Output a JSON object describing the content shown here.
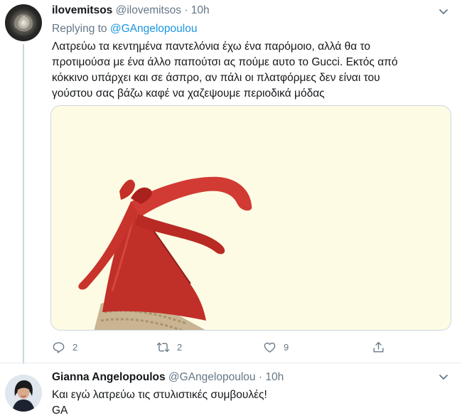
{
  "tweet1": {
    "name": "ilovemitsos",
    "handle": "@ilovemitsos",
    "separator": "·",
    "time": "10h",
    "replying_prefix": "Replying to",
    "replying_to": "@GAngelopoulou",
    "text_lines": [
      "Λατρεύω τα κεντημένα παντελόνια  έχω ένα παρόμοιο, αλλά θα το",
      "προτιμούσα με ένα άλλο παπούτσι ας πούμε αυτο το Gucci. Εκτός από",
      "κόκκινο υπάρχει και σε άσπρο, αν πάλι οι πλατφόρμες δεν είναι του",
      "γούστου σας βάζω καφέ να χαζεψουμε περιοδικά μόδας"
    ],
    "actions": {
      "reply_count": "2",
      "retweet_count": "2",
      "like_count": "9"
    },
    "icons": {
      "caret": "chevron-down-icon",
      "reply": "reply-icon",
      "retweet": "retweet-icon",
      "like": "heart-icon",
      "share": "share-icon"
    }
  },
  "tweet2": {
    "name": "Gianna Angelopoulos",
    "handle": "@GAngelopoulou",
    "separator": "·",
    "time": "10h",
    "text_lines": [
      "Και εγώ λατρεύω τις στυλιστικές συμβουλές!",
      "GA"
    ]
  },
  "colors": {
    "link": "#1b95e0",
    "muted": "#657786",
    "shoe_red": "#c4302b",
    "media_bg": "#fdfbe4"
  }
}
